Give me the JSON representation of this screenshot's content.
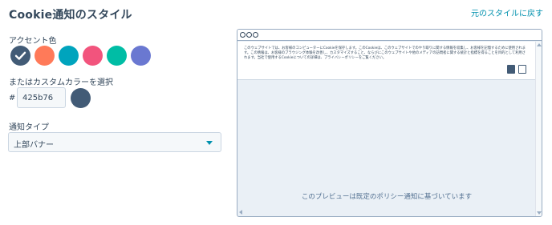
{
  "header": {
    "title": "Cookie通知のスタイル",
    "reset_link": "元のスタイルに戻す"
  },
  "accent": {
    "label": "アクセント色",
    "swatches": [
      {
        "name": "navy",
        "color": "#425b76",
        "selected": true
      },
      {
        "name": "orange",
        "color": "#ff7a59",
        "selected": false
      },
      {
        "name": "teal",
        "color": "#00a4bd",
        "selected": false
      },
      {
        "name": "pink",
        "color": "#f2547d",
        "selected": false
      },
      {
        "name": "green",
        "color": "#00bda5",
        "selected": false
      },
      {
        "name": "purple",
        "color": "#6a78d1",
        "selected": false
      }
    ]
  },
  "custom_color": {
    "label": "またはカスタムカラーを選択",
    "prefix": "#",
    "value": "425b76",
    "swatch_color": "#425b76"
  },
  "notice_type": {
    "label": "通知タイプ",
    "selected": "上部バナー"
  },
  "preview": {
    "banner_text": "このウェブサイトでは、お客様のコンピューターにCookieを保存します。このCookieは、このウェブサイトでのやり取りに関する情報を収集し、お客様を記憶するために使用されます。この情報は、お客様のブラウジング体験を改善し、カスタマイズすること、ならびにこのウェブサイトや他のメディアの訪問者に関する統計と指標を得ることを目的として利用されます。当社で使用するCookieについての詳細は、プライバシーポリシーをご覧ください。",
    "note": "このプレビューは既定のポリシー通知に基づいています",
    "accept_color": "#425b76"
  },
  "icons": {
    "check": "check-icon",
    "caret": "chevron-down-icon"
  }
}
